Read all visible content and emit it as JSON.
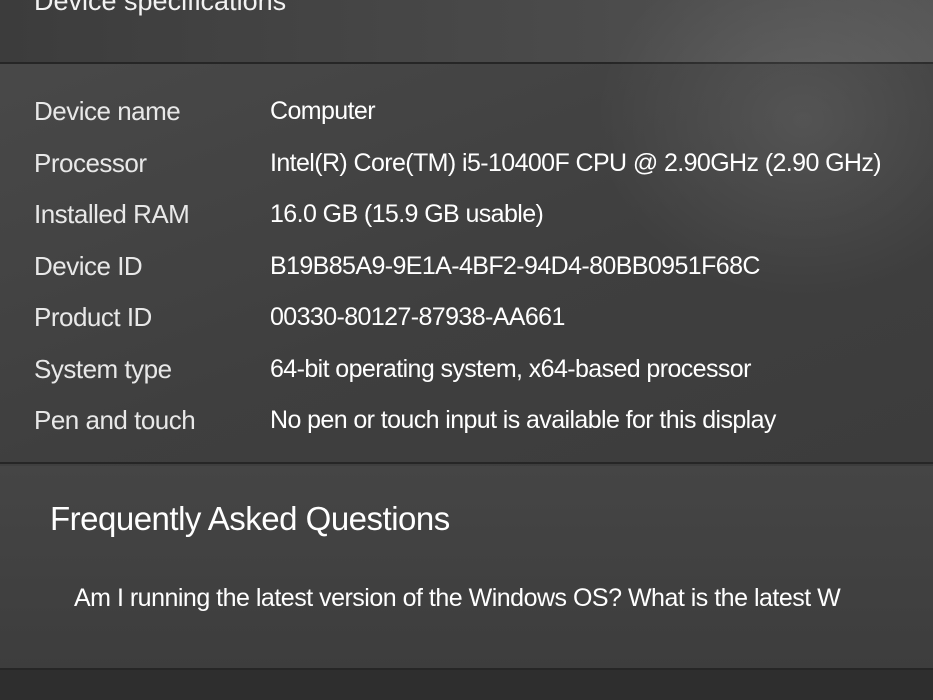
{
  "section_title": "Device specifications",
  "specs": [
    {
      "label": "Device name",
      "value": "Computer"
    },
    {
      "label": "Processor",
      "value": "Intel(R) Core(TM) i5-10400F CPU @ 2.90GHz (2.90 GHz)"
    },
    {
      "label": "Installed RAM",
      "value": "16.0 GB (15.9 GB usable)"
    },
    {
      "label": "Device ID",
      "value": "B19B85A9-9E1A-4BF2-94D4-80BB0951F68C"
    },
    {
      "label": "Product ID",
      "value": "00330-80127-87938-AA661"
    },
    {
      "label": "System type",
      "value": "64-bit operating system, x64-based processor"
    },
    {
      "label": "Pen and touch",
      "value": "No pen or touch input is available for this display"
    }
  ],
  "faq": {
    "title": "Frequently Asked Questions",
    "question": "Am I running the latest version of the Windows OS? What is the latest W"
  }
}
